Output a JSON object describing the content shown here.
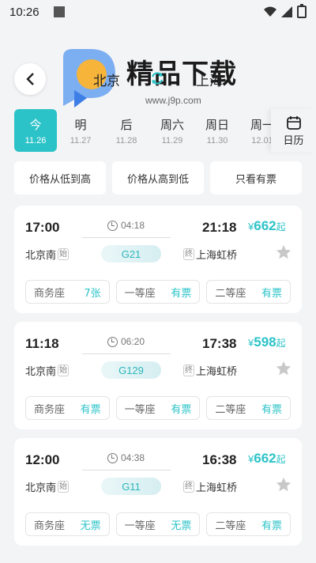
{
  "status_bar": {
    "time": "10:26"
  },
  "header": {
    "from_city": "北京",
    "to_city": "上海",
    "watermark_text": "精品下载",
    "watermark_url": "www.j9p.com"
  },
  "dates": [
    {
      "weekday": "今",
      "date": "11.26",
      "active": true
    },
    {
      "weekday": "明",
      "date": "11.27",
      "active": false
    },
    {
      "weekday": "后",
      "date": "11.28",
      "active": false
    },
    {
      "weekday": "周六",
      "date": "11.29",
      "active": false
    },
    {
      "weekday": "周日",
      "date": "11.30",
      "active": false
    },
    {
      "weekday": "周一",
      "date": "12.01",
      "active": false
    }
  ],
  "calendar_label": "日历",
  "sort_options": [
    "价格从低到高",
    "价格从高到低",
    "只看有票"
  ],
  "trains": [
    {
      "depart_time": "17:00",
      "arrive_time": "21:18",
      "duration": "04:18",
      "from_station": "北京南",
      "from_tag": "始",
      "to_station": "上海虹桥",
      "to_tag": "终",
      "train_no": "G21",
      "price_symbol": "¥",
      "price": "662",
      "price_suffix": "起",
      "seats": [
        {
          "name": "商务座",
          "availability": "7张"
        },
        {
          "name": "一等座",
          "availability": "有票"
        },
        {
          "name": "二等座",
          "availability": "有票"
        }
      ]
    },
    {
      "depart_time": "11:18",
      "arrive_time": "17:38",
      "duration": "06:20",
      "from_station": "北京南",
      "from_tag": "始",
      "to_station": "上海虹桥",
      "to_tag": "终",
      "train_no": "G129",
      "price_symbol": "¥",
      "price": "598",
      "price_suffix": "起",
      "seats": [
        {
          "name": "商务座",
          "availability": "有票"
        },
        {
          "name": "一等座",
          "availability": "有票"
        },
        {
          "name": "二等座",
          "availability": "有票"
        }
      ]
    },
    {
      "depart_time": "12:00",
      "arrive_time": "16:38",
      "duration": "04:38",
      "from_station": "北京南",
      "from_tag": "始",
      "to_station": "上海虹桥",
      "to_tag": "终",
      "train_no": "G11",
      "price_symbol": "¥",
      "price": "662",
      "price_suffix": "起",
      "seats": [
        {
          "name": "商务座",
          "availability": "无票"
        },
        {
          "name": "一等座",
          "availability": "无票"
        },
        {
          "name": "二等座",
          "availability": "有票"
        }
      ]
    }
  ],
  "colors": {
    "accent": "#2cc3c8",
    "background": "#f3f4f6",
    "star": "#c8c8c8"
  },
  "icons": [
    "back-arrow-icon",
    "swap-icon",
    "calendar-icon",
    "clock-icon",
    "star-icon",
    "wifi-icon",
    "signal-icon",
    "battery-icon"
  ]
}
